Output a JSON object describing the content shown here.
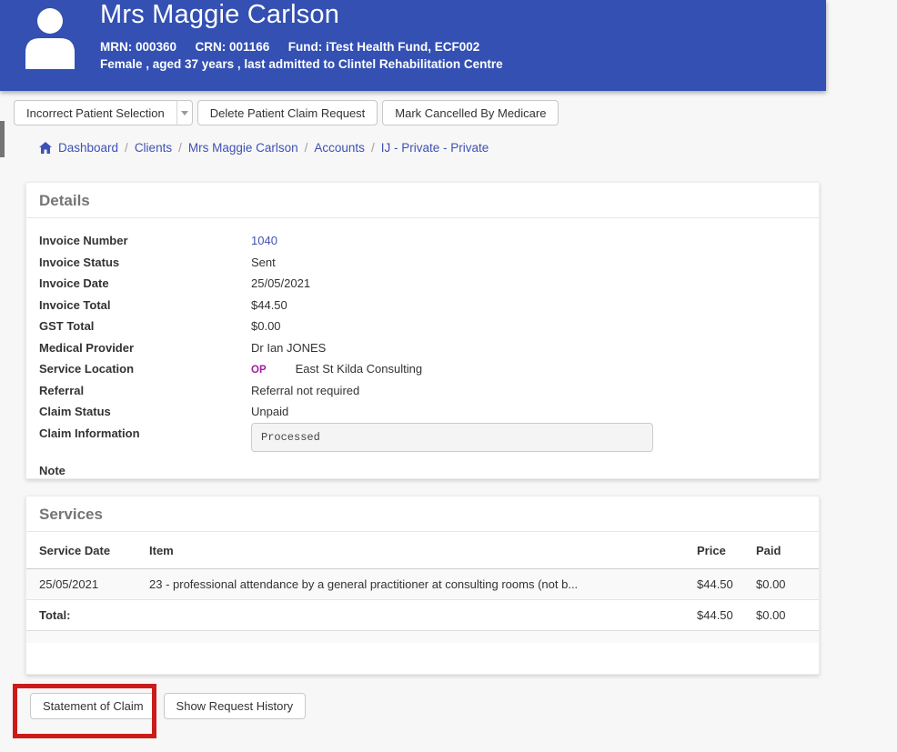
{
  "header": {
    "title": "Mrs Maggie Carlson",
    "meta": [
      "MRN: 000360",
      "CRN: 001166",
      "Fund: iTest Health Fund, ECF002"
    ],
    "demographics": "Female , aged 37 years , last admitted to Clintel Rehabilitation Centre"
  },
  "actions": {
    "incorrect_patient_selection": "Incorrect Patient Selection",
    "delete_claim_request": "Delete Patient Claim Request",
    "mark_cancelled": "Mark Cancelled By Medicare"
  },
  "breadcrumb": {
    "separator": "/",
    "items": [
      "Dashboard",
      "Clients",
      "Mrs Maggie Carlson",
      "Accounts",
      "IJ - Private - Private"
    ]
  },
  "details": {
    "title": "Details",
    "fields": [
      {
        "label": "Invoice Number",
        "value": "1040"
      },
      {
        "label": "Invoice Status",
        "value": "Sent"
      },
      {
        "label": "Invoice Date",
        "value": "25/05/2021"
      },
      {
        "label": "Invoice Total",
        "value": "$44.50"
      },
      {
        "label": "GST Total",
        "value": "$0.00"
      },
      {
        "label": "Medical Provider",
        "value": "Dr Ian JONES"
      },
      {
        "label": "Service Location",
        "badge": "OP",
        "value": "East St Kilda Consulting"
      },
      {
        "label": "Referral",
        "value": "Referral not required"
      },
      {
        "label": "Claim Status",
        "value": "Unpaid"
      },
      {
        "label": "Claim Information",
        "value": "Processed"
      },
      {
        "label": "Note",
        "value": ""
      }
    ]
  },
  "services": {
    "title": "Services",
    "columns": [
      "Service Date",
      "Item",
      "Price",
      "Paid"
    ],
    "rows": [
      {
        "service_date": "25/05/2021",
        "item": "23 - professional attendance by a general practitioner at consulting rooms (not b...",
        "price": "$44.50",
        "paid": "$0.00"
      }
    ],
    "total": {
      "label": "Total:",
      "price": "$44.50",
      "paid": "$0.00"
    }
  },
  "footer": {
    "statement_of_claim": "Statement of Claim",
    "show_request_history": "Show Request History"
  },
  "colors": {
    "header_bg": "#3350b2",
    "link": "#3f51b5",
    "op_badge": "#a2209e",
    "annotation_red": "#ca1d1a",
    "page_bg": "#f7f7f7"
  }
}
